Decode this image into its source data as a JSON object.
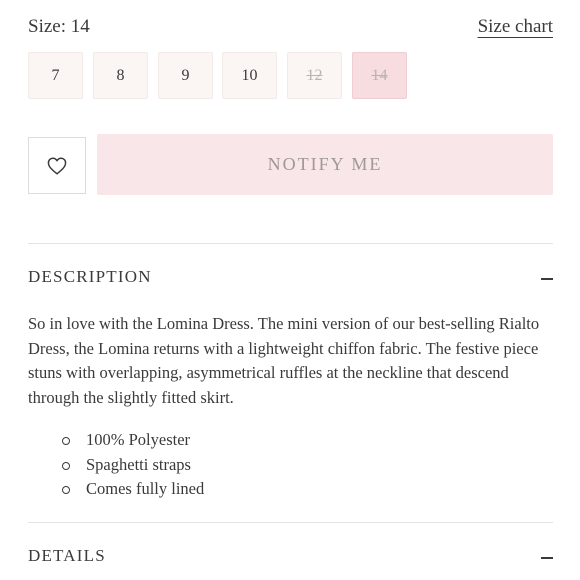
{
  "size": {
    "label": "Size: 14",
    "chart_link": "Size chart",
    "options": [
      {
        "label": "7",
        "available": true,
        "selected": false
      },
      {
        "label": "8",
        "available": true,
        "selected": false
      },
      {
        "label": "9",
        "available": true,
        "selected": false
      },
      {
        "label": "10",
        "available": true,
        "selected": false
      },
      {
        "label": "12",
        "available": false,
        "selected": false
      },
      {
        "label": "14",
        "available": false,
        "selected": true
      }
    ]
  },
  "actions": {
    "wishlist_icon": "heart-icon",
    "notify_label": "NOTIFY ME"
  },
  "description": {
    "title": "DESCRIPTION",
    "text": "So in love with the Lomina Dress. The mini version of our best-selling Rialto Dress, the Lomina returns with a lightweight chiffon fabric. The festive piece stuns with overlapping, asymmetrical ruffles at the neckline that descend through the slightly fitted skirt.",
    "bullets": [
      "100% Polyester",
      "Spaghetti straps",
      "Comes fully lined"
    ]
  },
  "details": {
    "title": "DETAILS"
  },
  "colors": {
    "accent_pink": "#f9e6e8",
    "selected_pink": "#f7dde0",
    "swatch_bg": "#fbf6f4",
    "text": "#3a3a3a"
  }
}
